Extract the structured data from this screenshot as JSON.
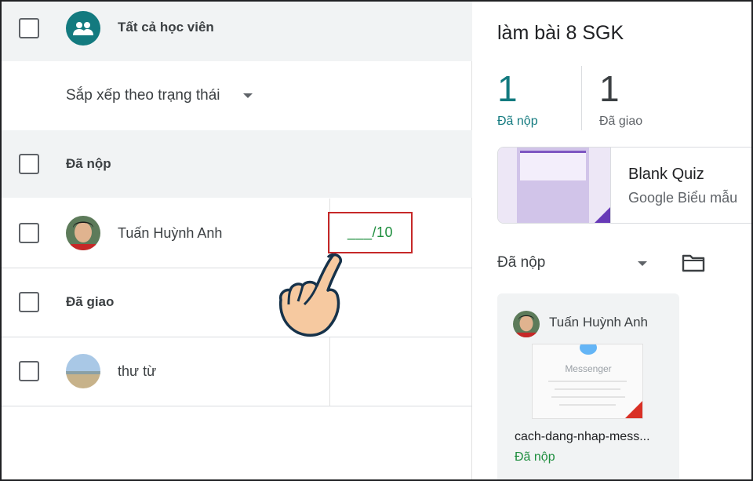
{
  "students_panel": {
    "all_students_label": "Tất cả học viên",
    "sort_label": "Sắp xếp theo trạng thái",
    "groups": [
      {
        "label": "Đã nộp",
        "students": [
          {
            "name": "Tuấn Huỳnh Anh",
            "grade": "___/10"
          }
        ]
      },
      {
        "label": "Đã giao",
        "students": [
          {
            "name": "thư từ"
          }
        ]
      }
    ]
  },
  "assignment": {
    "title": "làm bài 8 SGK",
    "stats": [
      {
        "value": "1",
        "label": "Đã nộp",
        "color": "#137a7f"
      },
      {
        "value": "1",
        "label": "Đã giao",
        "color": "#3c4043"
      }
    ],
    "attachment": {
      "title": "Blank Quiz",
      "type": "Google Biểu mẫu"
    },
    "filter_label": "Đã nộp",
    "submission": {
      "student": "Tuấn Huỳnh Anh",
      "thumbnail_text": "Messenger",
      "file_name": "cach-dang-nhap-mess...",
      "status": "Đã nộp"
    }
  },
  "icons": {
    "all_students": "people-icon",
    "sort_dropdown": "dropdown-arrow-icon",
    "folder": "folder-icon",
    "pointer": "pointing-hand-icon"
  },
  "colors": {
    "accent": "#137a7f",
    "grade": "#1e8e3e",
    "highlight_box": "#c62828"
  }
}
